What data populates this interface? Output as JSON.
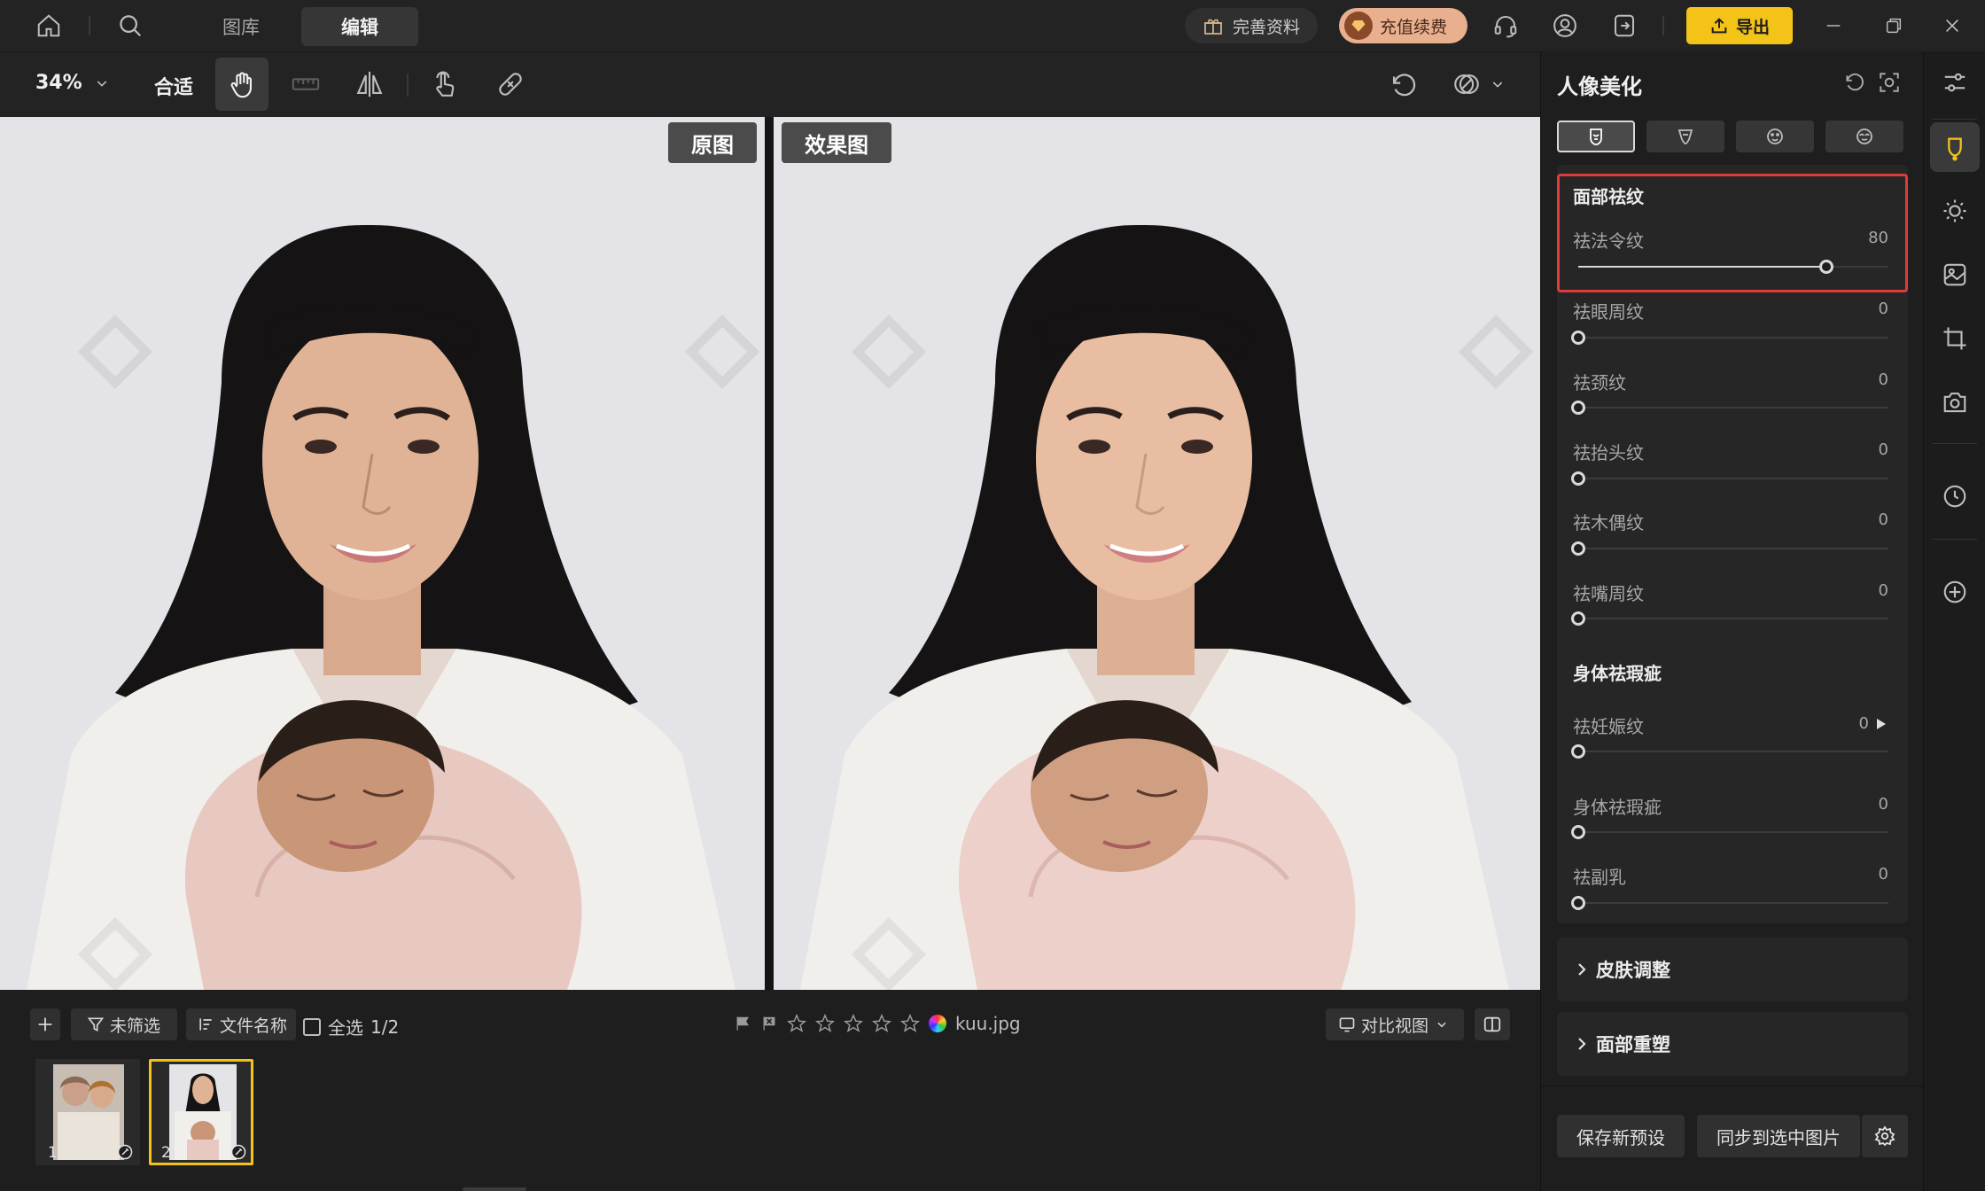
{
  "topbar": {
    "tabs": [
      "图库",
      "编辑"
    ],
    "active_tab": "编辑",
    "profile_btn": "完善资料",
    "recharge_btn": "充值续费",
    "export_btn": "导出",
    "accent": "#f3c317"
  },
  "toolbar": {
    "zoom": "34%",
    "fit": "合适"
  },
  "canvas": {
    "original_label": "原图",
    "result_label": "效果图"
  },
  "bottom": {
    "filter": "未筛选",
    "sort": "文件名称",
    "select_all": "全选",
    "count": "1/2",
    "filename": "kuu.jpg",
    "view_mode": "对比视图",
    "thumbnails": [
      {
        "index": "1",
        "selected": false
      },
      {
        "index": "2",
        "selected": true
      }
    ],
    "rating_stars": 0
  },
  "panel": {
    "title": "人像美化",
    "face_section": {
      "title": "面部祛纹",
      "sliders": [
        {
          "label": "祛法令纹",
          "value": "80",
          "percent": 80
        },
        {
          "label": "祛眼周纹",
          "value": "0",
          "percent": 0
        },
        {
          "label": "祛颈纹",
          "value": "0",
          "percent": 0
        },
        {
          "label": "祛抬头纹",
          "value": "0",
          "percent": 0
        },
        {
          "label": "祛木偶纹",
          "value": "0",
          "percent": 0
        },
        {
          "label": "祛嘴周纹",
          "value": "0",
          "percent": 0
        }
      ]
    },
    "body_section": {
      "title": "身体祛瑕疵",
      "sliders": [
        {
          "label": "祛妊娠纹",
          "value": "0",
          "percent": 0
        },
        {
          "label": "身体祛瑕疵",
          "value": "0",
          "percent": 0
        },
        {
          "label": "祛副乳",
          "value": "0",
          "percent": 0
        }
      ]
    },
    "skin_adjust": "皮肤调整",
    "face_reshape": "面部重塑",
    "save_preset": "保存新预设",
    "sync": "同步到选中图片",
    "highlight_color": "#e03a3a"
  }
}
